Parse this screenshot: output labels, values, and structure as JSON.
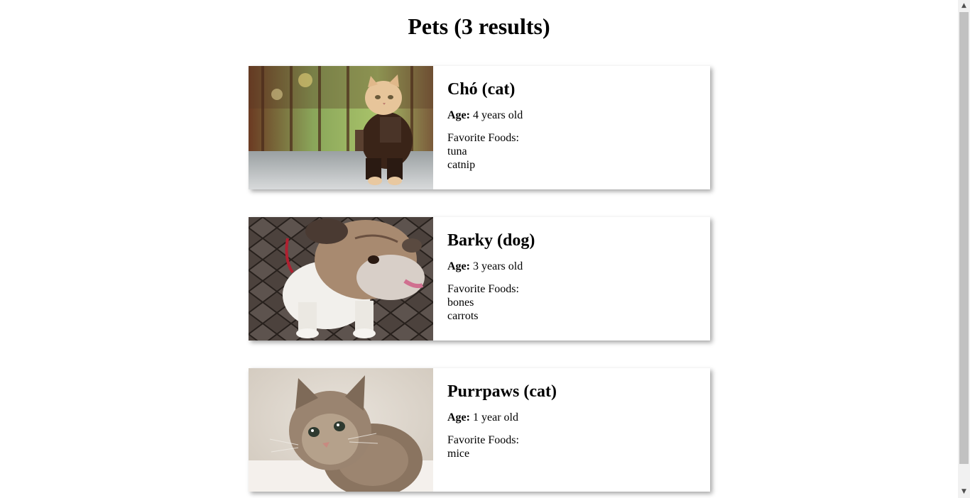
{
  "page": {
    "title": "Pets (3 results)"
  },
  "pets": [
    {
      "name": "Chó (cat)",
      "age_label": "Age:",
      "age_value": " 4 years old",
      "foods_label": "Favorite Foods:",
      "foods": [
        "tuna",
        "catnip"
      ],
      "photo": "cat-in-costume-photo"
    },
    {
      "name": "Barky (dog)",
      "age_label": "Age:",
      "age_value": " 3 years old",
      "foods_label": "Favorite Foods:",
      "foods": [
        "bones",
        "carrots"
      ],
      "photo": "bulldog-photo"
    },
    {
      "name": "Purrpaws (cat)",
      "age_label": "Age:",
      "age_value": " 1 year old",
      "foods_label": "Favorite Foods:",
      "foods": [
        "mice"
      ],
      "photo": "kitten-photo"
    }
  ],
  "scrollbar": {
    "up_icon": "chevron-up-icon",
    "down_icon": "chevron-down-icon"
  }
}
